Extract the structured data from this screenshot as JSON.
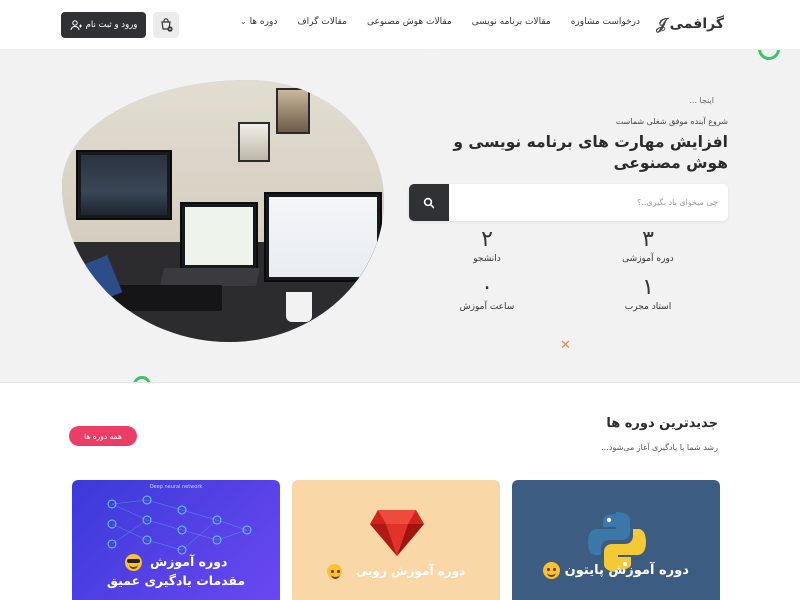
{
  "header": {
    "logo_text": "گرافمی",
    "nav": [
      {
        "label": "دوره ها"
      },
      {
        "label": "مقالات گراف"
      },
      {
        "label": "مقالات هوش مصنوعی"
      },
      {
        "label": "مقالات برنامه نویسی"
      },
      {
        "label": "درخواست مشاوره"
      }
    ],
    "login_label": "ورود و ثبت نام"
  },
  "hero": {
    "eyebrow": "اینجا ...",
    "subtitle": "شروع آینده موفق شغلی شماست",
    "title": "افزایش مهارت های برنامه نویسی و هوش مصنوعی",
    "search_placeholder": "چی میخوای یاد بگیری..؟",
    "stats": [
      {
        "value": "۳",
        "label": "دوره آموزشی"
      },
      {
        "value": "۲",
        "label": "دانشجو"
      },
      {
        "value": "۱",
        "label": "استاد مجرب"
      },
      {
        "value": "۰",
        "label": "ساعت آموزش"
      }
    ]
  },
  "courses_section": {
    "title": "جدیدترین دوره ها",
    "subtitle": "رشد شما با یادگیری آغاز می‌شود...",
    "all_button": "همه دوره ها",
    "cards": [
      {
        "title": "دوره آموزش پایتون",
        "bg": "#3d5c82"
      },
      {
        "title": "دوره آموزش روبی",
        "bg": "#f9d7a6"
      },
      {
        "title_line1": "دوره آموزش",
        "title_line2": "مقدمات یادگیری عمیق",
        "small_heading": "Deep neural network",
        "bg": "#4a4de0"
      }
    ]
  },
  "colors": {
    "dark": "#2f3135",
    "accent_pink": "#ec3d67",
    "green": "#3cc46a",
    "orange": "#f5863e"
  }
}
